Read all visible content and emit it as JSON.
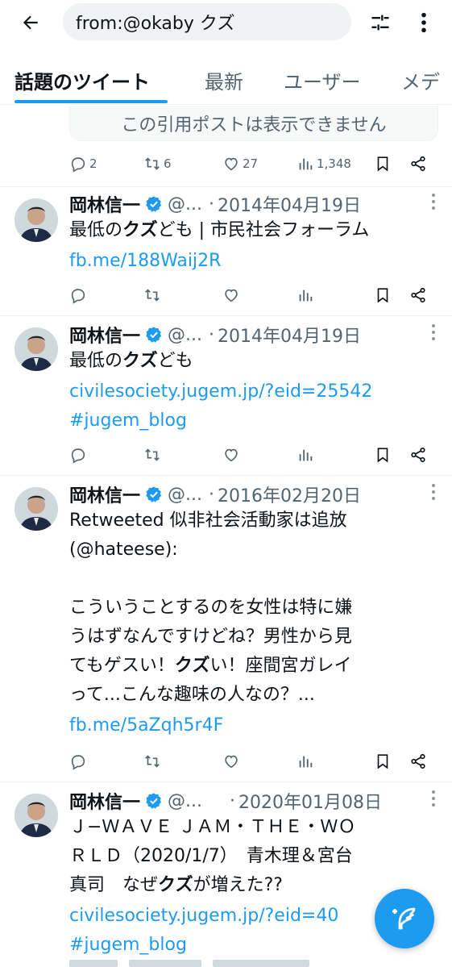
{
  "search": {
    "query": "from:@okaby クズ"
  },
  "tabs": [
    {
      "label": "話題のツイート"
    },
    {
      "label": "最新"
    },
    {
      "label": "ユーザー"
    },
    {
      "label": "メデ"
    }
  ],
  "quoted_unavailable": "この引用ポストは表示できません",
  "first_actions": {
    "replies": "2",
    "retweets": "6",
    "likes": "27",
    "views": "1,348"
  },
  "tweets": [
    {
      "author": "岡林信一",
      "handle": "@...",
      "dot": "·",
      "date": "2014年04月19日",
      "line1_pre": "最低の",
      "line1_bold": "クズ",
      "line1_post": "ども | 市民社会フォーラム",
      "link1": "fb.me/188Waij2R"
    },
    {
      "author": "岡林信一",
      "handle": "@...",
      "dot": "·",
      "date": "2014年04月19日",
      "line1_pre": "最低の",
      "line1_bold": "クズ",
      "line1_post": "ども",
      "link1": "civilesociety.jugem.jp/?eid=25542",
      "link2": "#jugem_blog"
    },
    {
      "author": "岡林信一",
      "handle": "@...",
      "dot": "·",
      "date": "2016年02月20日",
      "line1": "Retweeted 似非社会活動家は追放",
      "line2": "(@hateese):",
      "line3": "こういうことするのを女性は特に嫌",
      "line4": "うはずなんですけどね？男性から見",
      "line5_pre": "てもゲスい！",
      "line5_bold": "クズ",
      "line5_post": "い！座間宮ガレイ",
      "line6": "って...こんな趣味の人なの？...",
      "link1": "fb.me/5aZqh5r4F"
    },
    {
      "author": "岡林信一",
      "handle": "@...",
      "dot": "·",
      "date": "2020年01月08日",
      "line1": "Ｊ−ＷＡＶＥ ＪＡＭ・ＴＨＥ・ＷＯ",
      "line2": "ＲＬＤ（2020/1/7）　青木理＆宮台",
      "line3_pre": "真司　なぜ",
      "line3_bold": "クズ",
      "line3_post": "が増えた??",
      "link1": "civilesociety.jugem.jp/?eid=40",
      "link2": "#jugem_blog"
    }
  ],
  "colors": {
    "accent": "#1d9bf0",
    "text": "#0f1419",
    "muted": "#536471",
    "verified": "#1d9bf0"
  }
}
